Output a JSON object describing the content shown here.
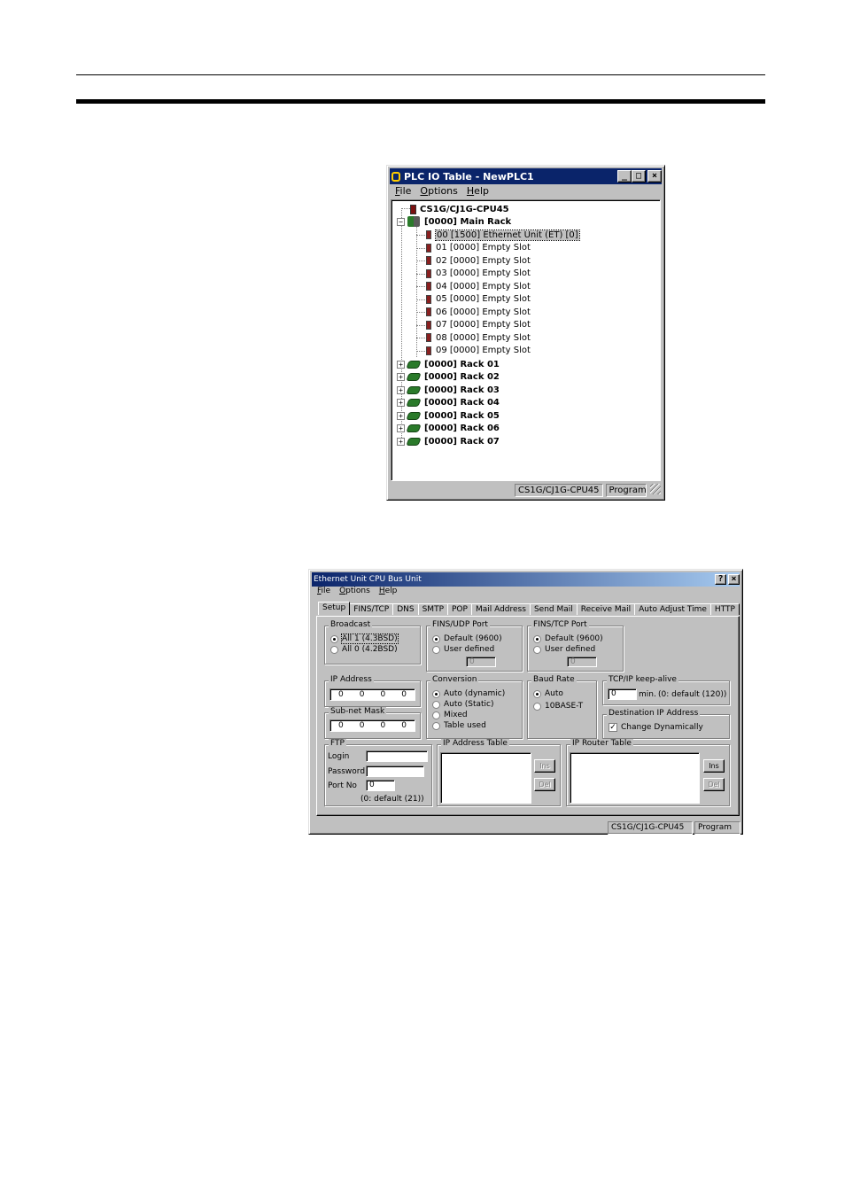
{
  "plc_window": {
    "title": "PLC IO Table - NewPLC1",
    "menu": [
      "File",
      "Options",
      "Help"
    ],
    "tree": {
      "cpu": "CS1G/CJ1G-CPU45",
      "main_rack": "[0000] Main Rack",
      "slots": [
        "00 [1500] Ethernet Unit (ET) [0]",
        "01 [0000] Empty Slot",
        "02 [0000] Empty Slot",
        "03 [0000] Empty Slot",
        "04 [0000] Empty Slot",
        "05 [0000] Empty Slot",
        "06 [0000] Empty Slot",
        "07 [0000] Empty Slot",
        "08 [0000] Empty Slot",
        "09 [0000] Empty Slot"
      ],
      "racks": [
        "[0000] Rack 01",
        "[0000] Rack 02",
        "[0000] Rack 03",
        "[0000] Rack 04",
        "[0000] Rack 05",
        "[0000] Rack 06",
        "[0000] Rack 07"
      ]
    },
    "status": {
      "cpu": "CS1G/CJ1G-CPU45",
      "mode": "Program"
    }
  },
  "eth_window": {
    "title": "Ethernet Unit CPU Bus Unit",
    "menu": [
      "File",
      "Options",
      "Help"
    ],
    "tabs": [
      "Setup",
      "FINS/TCP",
      "DNS",
      "SMTP",
      "POP",
      "Mail Address",
      "Send Mail",
      "Receive Mail",
      "Auto Adjust Time",
      "HTTP"
    ],
    "broadcast": {
      "label": "Broadcast",
      "opt1": "All 1 (4.3BSD)",
      "opt2": "All 0 (4.2BSD)"
    },
    "fins_udp": {
      "label": "FINS/UDP Port",
      "opt1": "Default (9600)",
      "opt2": "User defined",
      "value": "0"
    },
    "fins_tcp": {
      "label": "FINS/TCP Port",
      "opt1": "Default (9600)",
      "opt2": "User defined",
      "value": "0"
    },
    "ip_address": {
      "label": "IP Address",
      "octets": [
        "0",
        "0",
        "0",
        "0"
      ]
    },
    "subnet": {
      "label": "Sub-net Mask",
      "octets": [
        "0",
        "0",
        "0",
        "0"
      ]
    },
    "conversion": {
      "label": "Conversion",
      "opts": [
        "Auto (dynamic)",
        "Auto (Static)",
        "Mixed",
        "Table used"
      ]
    },
    "baud": {
      "label": "Baud Rate",
      "opt1": "Auto",
      "opt2": "10BASE-T"
    },
    "keepalive": {
      "label": "TCP/IP keep-alive",
      "value": "0",
      "unit": "min.",
      "hint": "(0: default (120))"
    },
    "dest_ip": {
      "label": "Destination IP Address",
      "check": "Change Dynamically"
    },
    "ftp": {
      "label": "FTP",
      "login": "Login",
      "password": "Password",
      "port": "Port No",
      "port_value": "0",
      "hint": "(0: default (21))"
    },
    "ip_table": {
      "label": "IP Address Table",
      "ins": "Ins",
      "del": "Del"
    },
    "router_table": {
      "label": "IP Router Table",
      "ins": "Ins",
      "del": "Del"
    },
    "status": {
      "cpu": "CS1G/CJ1G-CPU45",
      "mode": "Program"
    }
  }
}
